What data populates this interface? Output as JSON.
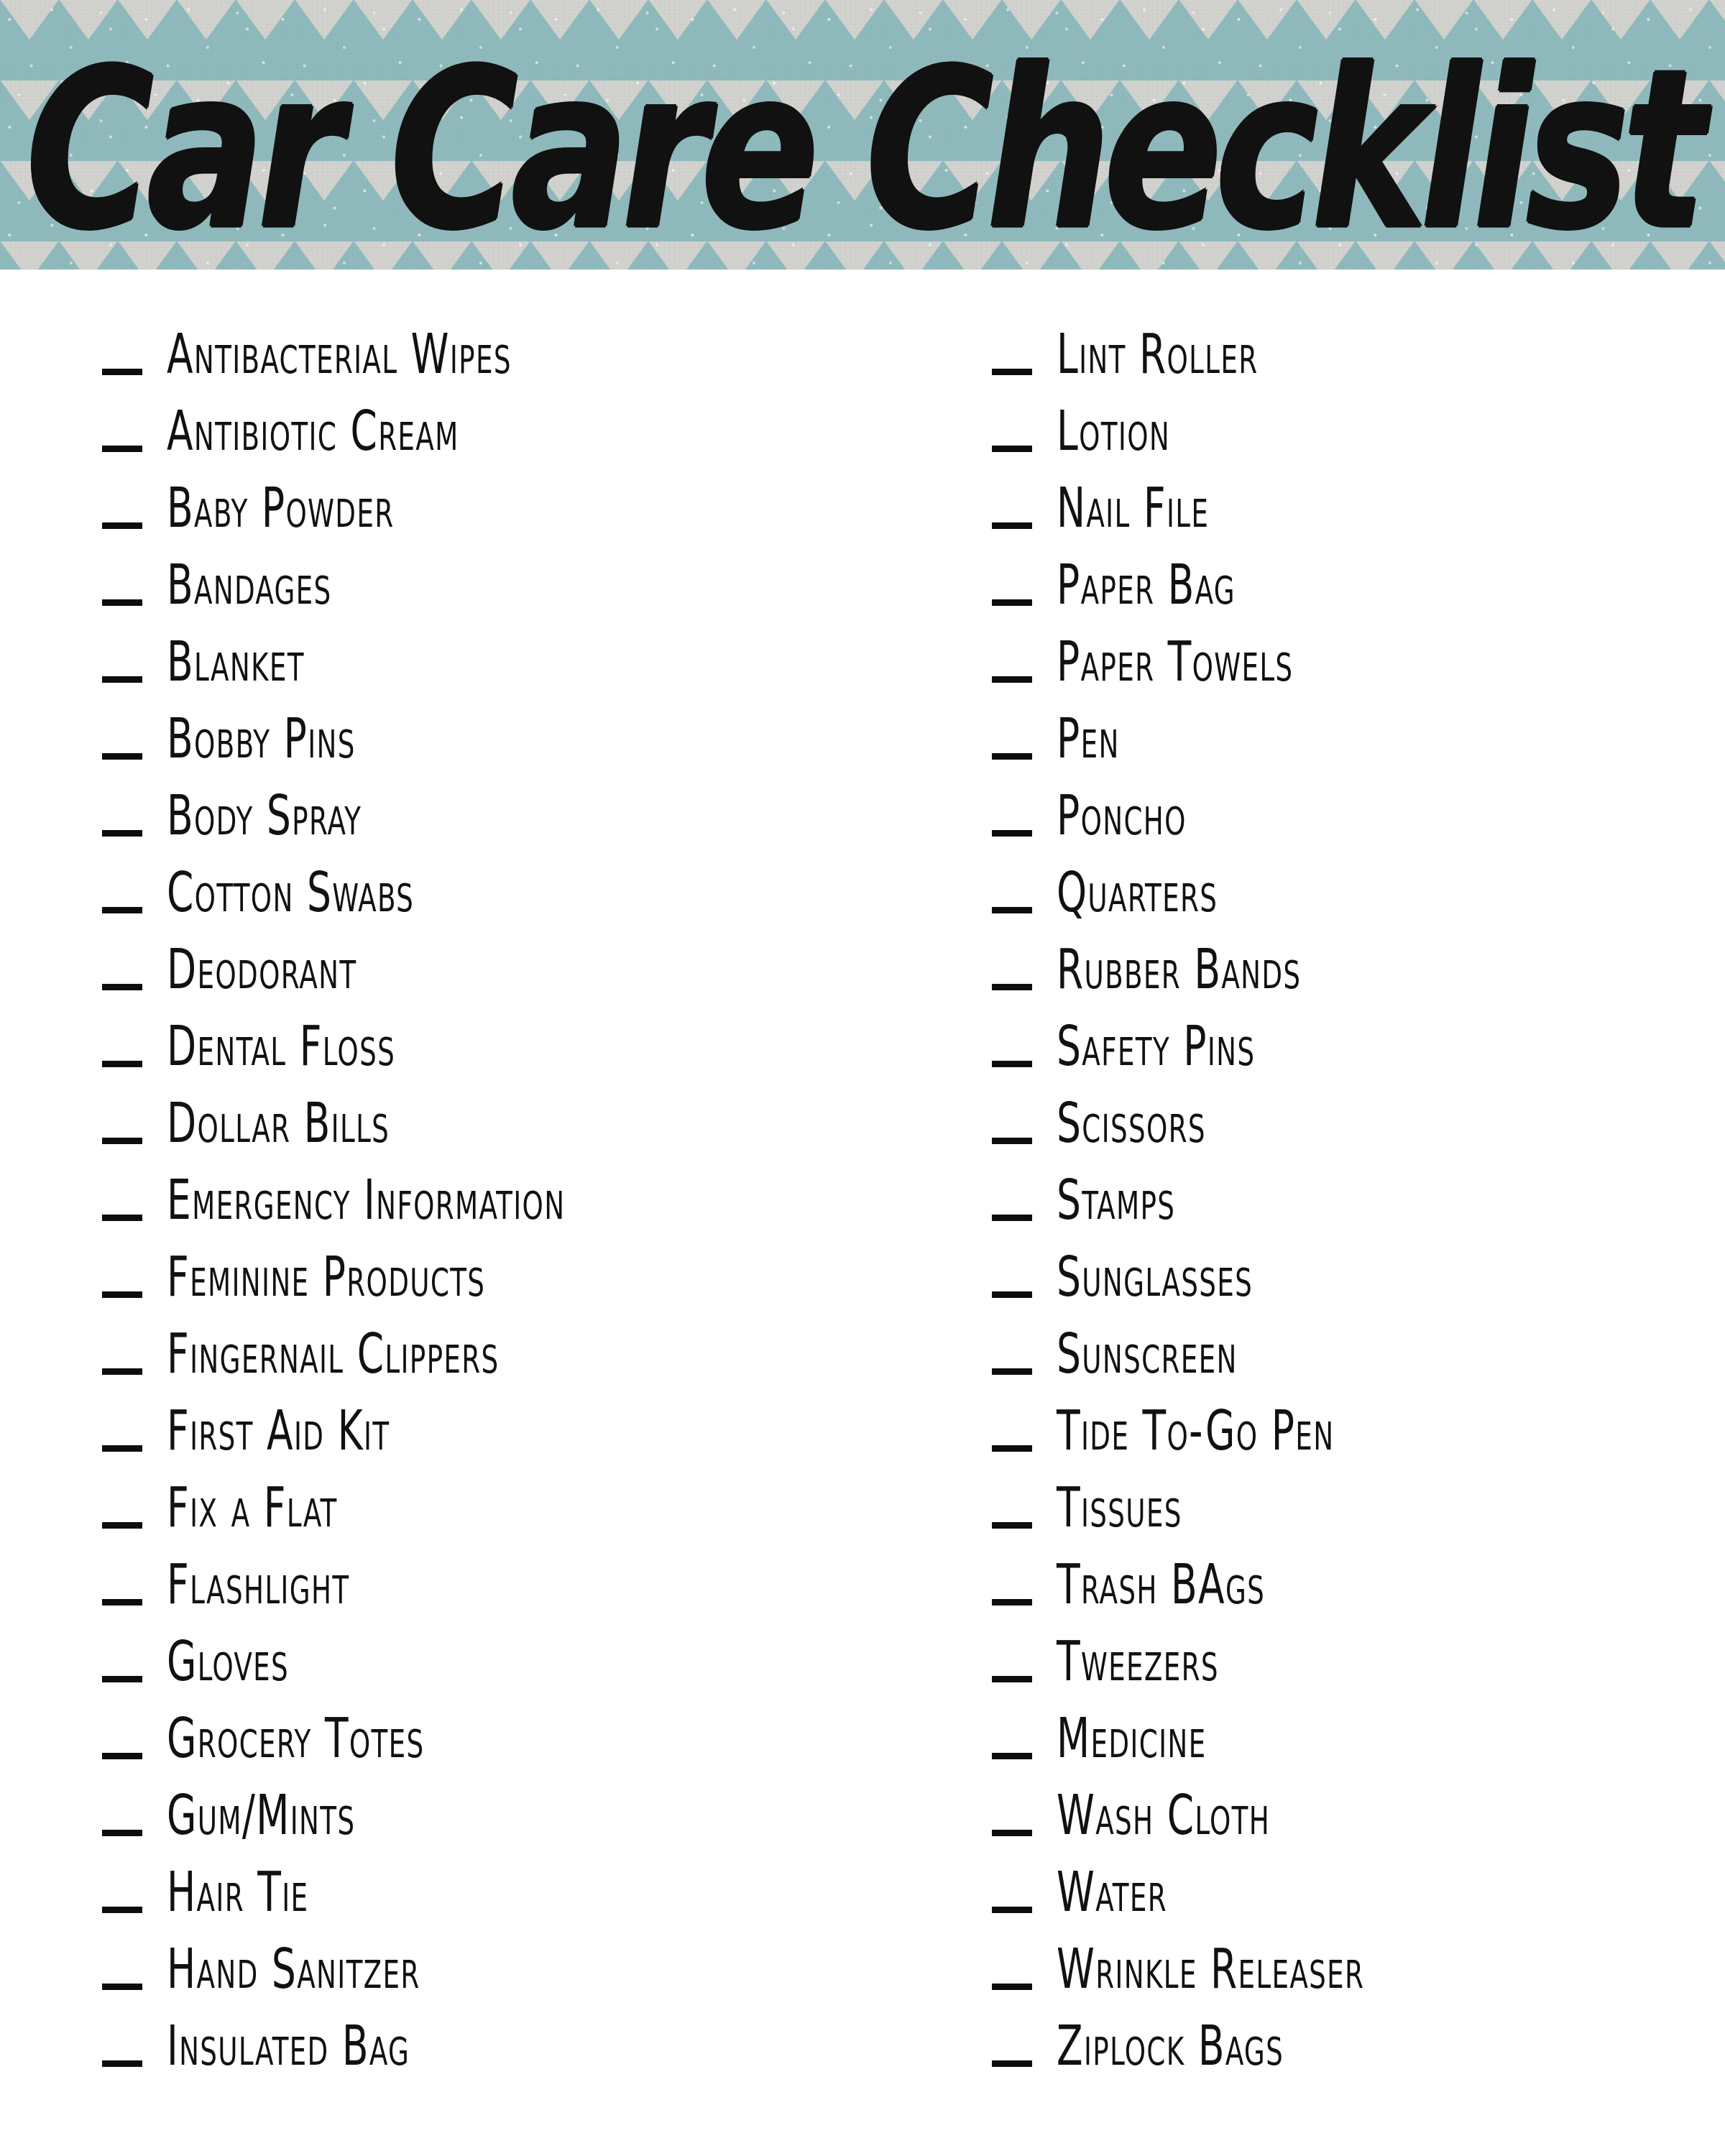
{
  "page": {
    "title": "Car Care Checklist",
    "background_color": "#ffffff"
  },
  "banner": {
    "title": "Car Care Checklist",
    "background_color": "#d2d2cf",
    "accent_color": "#8fbabd",
    "pattern": "downward-triangles",
    "title_color": "#111111"
  },
  "checklist": {
    "blank_mark": "_",
    "left_column": [
      {
        "label": "Antibacterial Wipes",
        "checked": false
      },
      {
        "label": "Antibiotic Cream",
        "checked": false
      },
      {
        "label": "Baby Powder",
        "checked": false
      },
      {
        "label": "Bandages",
        "checked": false
      },
      {
        "label": "Blanket",
        "checked": false
      },
      {
        "label": "Bobby Pins",
        "checked": false
      },
      {
        "label": "Body Spray",
        "checked": false
      },
      {
        "label": "Cotton Swabs",
        "checked": false
      },
      {
        "label": "Deodorant",
        "checked": false
      },
      {
        "label": "Dental Floss",
        "checked": false
      },
      {
        "label": "Dollar Bills",
        "checked": false
      },
      {
        "label": "Emergency Information",
        "checked": false
      },
      {
        "label": "Feminine Products",
        "checked": false
      },
      {
        "label": "Fingernail Clippers",
        "checked": false
      },
      {
        "label": "First Aid Kit",
        "checked": false
      },
      {
        "label": "Fix a Flat",
        "checked": false
      },
      {
        "label": "Flashlight",
        "checked": false
      },
      {
        "label": "Gloves",
        "checked": false
      },
      {
        "label": "Grocery Totes",
        "checked": false
      },
      {
        "label": "Gum/Mints",
        "checked": false
      },
      {
        "label": "Hair Tie",
        "checked": false
      },
      {
        "label": "Hand Sanitzer",
        "checked": false
      },
      {
        "label": "Insulated Bag",
        "checked": false
      }
    ],
    "right_column": [
      {
        "label": "Lint Roller",
        "checked": false
      },
      {
        "label": "Lotion",
        "checked": false
      },
      {
        "label": "Nail File",
        "checked": false
      },
      {
        "label": "Paper Bag",
        "checked": false
      },
      {
        "label": "Paper Towels",
        "checked": false
      },
      {
        "label": "Pen",
        "checked": false
      },
      {
        "label": "Poncho",
        "checked": false
      },
      {
        "label": "Quarters",
        "checked": false
      },
      {
        "label": "Rubber Bands",
        "checked": false
      },
      {
        "label": "Safety Pins",
        "checked": false
      },
      {
        "label": "Scissors",
        "checked": false
      },
      {
        "label": "Stamps",
        "checked": false
      },
      {
        "label": "Sunglasses",
        "checked": false
      },
      {
        "label": "Sunscreen",
        "checked": false
      },
      {
        "label": "Tide To-Go Pen",
        "checked": false
      },
      {
        "label": "Tissues",
        "checked": false
      },
      {
        "label": "Trash BAgs",
        "checked": false
      },
      {
        "label": "Tweezers",
        "checked": false
      },
      {
        "label": "Medicine",
        "checked": false
      },
      {
        "label": "Wash Cloth",
        "checked": false
      },
      {
        "label": "Water",
        "checked": false
      },
      {
        "label": "Wrinkle Releaser",
        "checked": false
      },
      {
        "label": "Ziplock Bags",
        "checked": false
      }
    ]
  }
}
